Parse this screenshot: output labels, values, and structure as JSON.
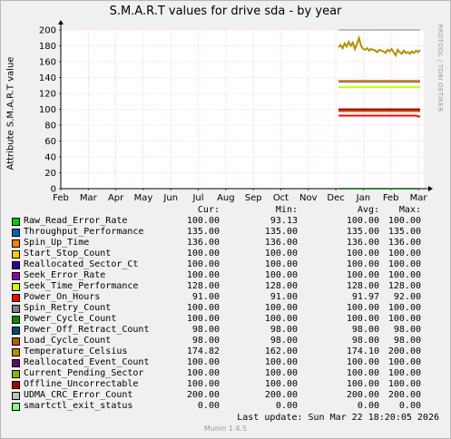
{
  "chart_data": {
    "type": "line",
    "title": "S.M.A.R.T values for drive sda - by year",
    "ylabel": "Attribute S.M.A.R.T value",
    "xlabel": "",
    "ylim": [
      0,
      200
    ],
    "yticks": [
      0,
      20,
      40,
      60,
      80,
      100,
      120,
      140,
      160,
      180,
      200
    ],
    "xticks": [
      "Feb",
      "Mar",
      "Apr",
      "May",
      "Jun",
      "Jul",
      "Aug",
      "Sep",
      "Oct",
      "Nov",
      "Dec",
      "Jan",
      "Feb",
      "Mar"
    ],
    "grid": true,
    "watermark": "RRDTOOL / TOBI OETIKER",
    "columns": {
      "cur": "Cur:",
      "min": "Min:",
      "avg": "Avg:",
      "max": "Max:"
    },
    "series": [
      {
        "name": "Raw_Read_Error_Rate",
        "color": "#00cc00",
        "cur": "100.00",
        "min": "93.13",
        "avg": "100.00",
        "max": "100.00",
        "values": [
          100,
          100,
          100,
          100,
          100,
          100,
          100,
          100,
          100,
          100,
          100,
          100,
          100,
          100,
          100,
          100,
          100,
          100,
          100,
          100,
          100,
          100,
          100,
          100,
          100,
          100,
          100,
          100,
          100,
          100,
          100,
          100,
          100,
          100,
          100,
          100,
          100,
          100,
          100,
          100,
          100
        ]
      },
      {
        "name": "Throughput_Performance",
        "color": "#0066b3",
        "cur": "135.00",
        "min": "135.00",
        "avg": "135.00",
        "max": "135.00",
        "values": [
          135,
          135,
          135,
          135,
          135,
          135,
          135,
          135,
          135,
          135,
          135,
          135,
          135,
          135,
          135,
          135,
          135,
          135,
          135,
          135,
          135,
          135,
          135,
          135,
          135,
          135,
          135,
          135,
          135,
          135,
          135,
          135,
          135,
          135,
          135,
          135,
          135,
          135,
          135,
          135,
          135
        ]
      },
      {
        "name": "Spin_Up_Time",
        "color": "#ff8000",
        "cur": "136.00",
        "min": "136.00",
        "avg": "136.00",
        "max": "136.00",
        "values": [
          136,
          136,
          136,
          136,
          136,
          136,
          136,
          136,
          136,
          136,
          136,
          136,
          136,
          136,
          136,
          136,
          136,
          136,
          136,
          136,
          136,
          136,
          136,
          136,
          136,
          136,
          136,
          136,
          136,
          136,
          136,
          136,
          136,
          136,
          136,
          136,
          136,
          136,
          136,
          136,
          136
        ]
      },
      {
        "name": "Start_Stop_Count",
        "color": "#ffcc00",
        "cur": "100.00",
        "min": "100.00",
        "avg": "100.00",
        "max": "100.00",
        "values": [
          100,
          100,
          100,
          100,
          100,
          100,
          100,
          100,
          100,
          100,
          100,
          100,
          100,
          100,
          100,
          100,
          100,
          100,
          100,
          100,
          100,
          100,
          100,
          100,
          100,
          100,
          100,
          100,
          100,
          100,
          100,
          100,
          100,
          100,
          100,
          100,
          100,
          100,
          100,
          100,
          100
        ]
      },
      {
        "name": "Reallocated_Sector_Ct",
        "color": "#330099",
        "cur": "100.00",
        "min": "100.00",
        "avg": "100.00",
        "max": "100.00",
        "values": [
          100,
          100,
          100,
          100,
          100,
          100,
          100,
          100,
          100,
          100,
          100,
          100,
          100,
          100,
          100,
          100,
          100,
          100,
          100,
          100,
          100,
          100,
          100,
          100,
          100,
          100,
          100,
          100,
          100,
          100,
          100,
          100,
          100,
          100,
          100,
          100,
          100,
          100,
          100,
          100,
          100
        ]
      },
      {
        "name": "Seek_Error_Rate",
        "color": "#990099",
        "cur": "100.00",
        "min": "100.00",
        "avg": "100.00",
        "max": "100.00",
        "values": [
          100,
          100,
          100,
          100,
          100,
          100,
          100,
          100,
          100,
          100,
          100,
          100,
          100,
          100,
          100,
          100,
          100,
          100,
          100,
          100,
          100,
          100,
          100,
          100,
          100,
          100,
          100,
          100,
          100,
          100,
          100,
          100,
          100,
          100,
          100,
          100,
          100,
          100,
          100,
          100,
          100
        ]
      },
      {
        "name": "Seek_Time_Performance",
        "color": "#ccff00",
        "cur": "128.00",
        "min": "128.00",
        "avg": "128.00",
        "max": "128.00",
        "values": [
          128,
          128,
          128,
          128,
          128,
          128,
          128,
          128,
          128,
          128,
          128,
          128,
          128,
          128,
          128,
          128,
          128,
          128,
          128,
          128,
          128,
          128,
          128,
          128,
          128,
          128,
          128,
          128,
          128,
          128,
          128,
          128,
          128,
          128,
          128,
          128,
          128,
          128,
          128,
          128,
          128
        ]
      },
      {
        "name": "Power_On_Hours",
        "color": "#ff0000",
        "cur": "91.00",
        "min": "91.00",
        "avg": "91.97",
        "max": "92.00",
        "values": [
          92,
          92,
          92,
          92,
          92,
          92,
          92,
          92,
          92,
          92,
          92,
          92,
          92,
          92,
          92,
          92,
          92,
          92,
          92,
          92,
          92,
          92,
          92,
          92,
          92,
          92,
          92,
          92,
          92,
          92,
          92,
          92,
          92,
          92,
          92,
          92,
          92,
          92,
          92,
          91,
          91
        ]
      },
      {
        "name": "Spin_Retry_Count",
        "color": "#808080",
        "cur": "100.00",
        "min": "100.00",
        "avg": "100.00",
        "max": "100.00",
        "values": [
          100,
          100,
          100,
          100,
          100,
          100,
          100,
          100,
          100,
          100,
          100,
          100,
          100,
          100,
          100,
          100,
          100,
          100,
          100,
          100,
          100,
          100,
          100,
          100,
          100,
          100,
          100,
          100,
          100,
          100,
          100,
          100,
          100,
          100,
          100,
          100,
          100,
          100,
          100,
          100,
          100
        ]
      },
      {
        "name": "Power_Cycle_Count",
        "color": "#008f00",
        "cur": "100.00",
        "min": "100.00",
        "avg": "100.00",
        "max": "100.00",
        "values": [
          100,
          100,
          100,
          100,
          100,
          100,
          100,
          100,
          100,
          100,
          100,
          100,
          100,
          100,
          100,
          100,
          100,
          100,
          100,
          100,
          100,
          100,
          100,
          100,
          100,
          100,
          100,
          100,
          100,
          100,
          100,
          100,
          100,
          100,
          100,
          100,
          100,
          100,
          100,
          100,
          100
        ]
      },
      {
        "name": "Power_Off_Retract_Count",
        "color": "#00487d",
        "cur": "98.00",
        "min": "98.00",
        "avg": "98.00",
        "max": "98.00",
        "values": [
          98,
          98,
          98,
          98,
          98,
          98,
          98,
          98,
          98,
          98,
          98,
          98,
          98,
          98,
          98,
          98,
          98,
          98,
          98,
          98,
          98,
          98,
          98,
          98,
          98,
          98,
          98,
          98,
          98,
          98,
          98,
          98,
          98,
          98,
          98,
          98,
          98,
          98,
          98,
          98,
          98
        ]
      },
      {
        "name": "Load_Cycle_Count",
        "color": "#b35a00",
        "cur": "98.00",
        "min": "98.00",
        "avg": "98.00",
        "max": "98.00",
        "values": [
          98,
          98,
          98,
          98,
          98,
          98,
          98,
          98,
          98,
          98,
          98,
          98,
          98,
          98,
          98,
          98,
          98,
          98,
          98,
          98,
          98,
          98,
          98,
          98,
          98,
          98,
          98,
          98,
          98,
          98,
          98,
          98,
          98,
          98,
          98,
          98,
          98,
          98,
          98,
          98,
          98
        ]
      },
      {
        "name": "Temperature_Celsius",
        "color": "#b38f00",
        "cur": "174.82",
        "min": "162.00",
        "avg": "174.10",
        "max": "200.00",
        "values": [
          178,
          181,
          177,
          183,
          179,
          185,
          180,
          184,
          176,
          182,
          190,
          180,
          176,
          175,
          177,
          174,
          176,
          175,
          174,
          172,
          175,
          174,
          173,
          171,
          175,
          173,
          176,
          172,
          168,
          175,
          172,
          170,
          174,
          171,
          172,
          170,
          173,
          171,
          174,
          172,
          175
        ]
      },
      {
        "name": "Reallocated_Event_Count",
        "color": "#6b006b",
        "cur": "100.00",
        "min": "100.00",
        "avg": "100.00",
        "max": "100.00",
        "values": [
          100,
          100,
          100,
          100,
          100,
          100,
          100,
          100,
          100,
          100,
          100,
          100,
          100,
          100,
          100,
          100,
          100,
          100,
          100,
          100,
          100,
          100,
          100,
          100,
          100,
          100,
          100,
          100,
          100,
          100,
          100,
          100,
          100,
          100,
          100,
          100,
          100,
          100,
          100,
          100,
          100
        ]
      },
      {
        "name": "Current_Pending_Sector",
        "color": "#8fb300",
        "cur": "100.00",
        "min": "100.00",
        "avg": "100.00",
        "max": "100.00",
        "values": [
          100,
          100,
          100,
          100,
          100,
          100,
          100,
          100,
          100,
          100,
          100,
          100,
          100,
          100,
          100,
          100,
          100,
          100,
          100,
          100,
          100,
          100,
          100,
          100,
          100,
          100,
          100,
          100,
          100,
          100,
          100,
          100,
          100,
          100,
          100,
          100,
          100,
          100,
          100,
          100,
          100
        ]
      },
      {
        "name": "Offline_Uncorrectable",
        "color": "#b30000",
        "cur": "100.00",
        "min": "100.00",
        "avg": "100.00",
        "max": "100.00",
        "values": [
          100,
          100,
          100,
          100,
          100,
          100,
          100,
          100,
          100,
          100,
          100,
          100,
          100,
          100,
          100,
          100,
          100,
          100,
          100,
          100,
          100,
          100,
          100,
          100,
          100,
          100,
          100,
          100,
          100,
          100,
          100,
          100,
          100,
          100,
          100,
          100,
          100,
          100,
          100,
          100,
          100
        ]
      },
      {
        "name": "UDMA_CRC_Error_Count",
        "color": "#bebebe",
        "cur": "200.00",
        "min": "200.00",
        "avg": "200.00",
        "max": "200.00",
        "values": [
          200,
          200,
          200,
          200,
          200,
          200,
          200,
          200,
          200,
          200,
          200,
          200,
          200,
          200,
          200,
          200,
          200,
          200,
          200,
          200,
          200,
          200,
          200,
          200,
          200,
          200,
          200,
          200,
          200,
          200,
          200,
          200,
          200,
          200,
          200,
          200,
          200,
          200,
          200,
          200,
          200
        ]
      },
      {
        "name": "smartctl_exit_status",
        "color": "#80ff80",
        "cur": "0.00",
        "min": "0.00",
        "avg": "0.00",
        "max": "0.00",
        "values": [
          0,
          0,
          0,
          0,
          0,
          0,
          0,
          0,
          0,
          0,
          0,
          0,
          0,
          0,
          0,
          0,
          0,
          0,
          0,
          0,
          0,
          0,
          0,
          0,
          0,
          0,
          0,
          0,
          0,
          0,
          0,
          0,
          0,
          0,
          0,
          0,
          0,
          0,
          0,
          0,
          0
        ]
      }
    ],
    "last_update": "Last update:  Sun Mar 22 18:20:05 2026",
    "version": "Munin 1.4.5"
  }
}
